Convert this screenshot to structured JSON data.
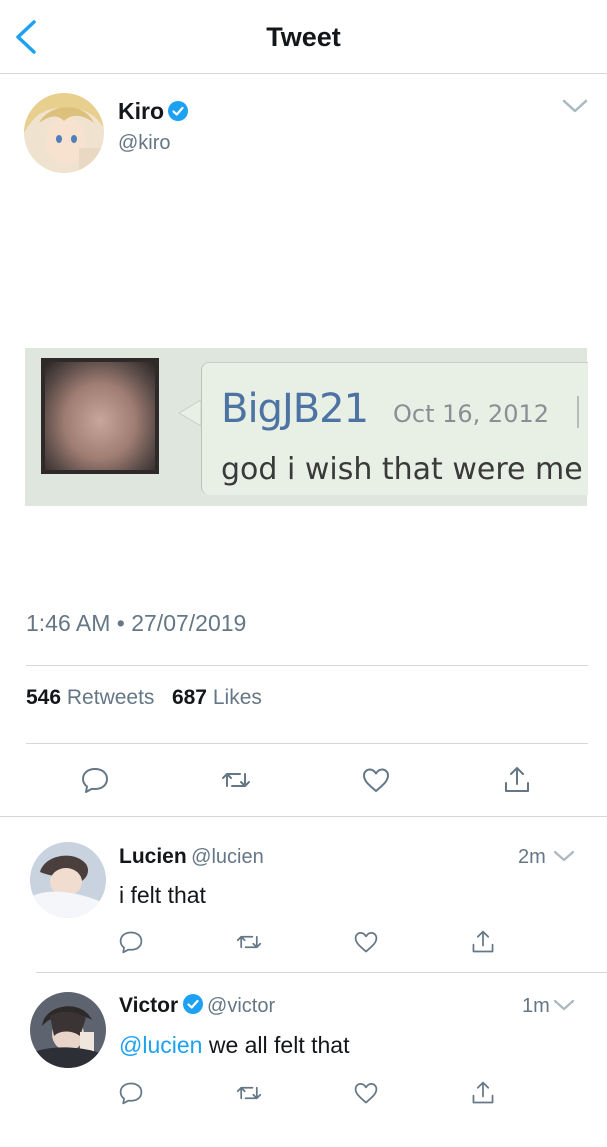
{
  "header": {
    "title": "Tweet"
  },
  "tweet": {
    "author_name": "Kiro",
    "author_handle": "@kiro",
    "timestamp": "1:46 AM • 27/07/2019",
    "retweets_count": "546",
    "retweets_label": "Retweets",
    "likes_count": "687",
    "likes_label": "Likes",
    "embedded": {
      "username": "BigJB21",
      "date": "Oct 16, 2012",
      "text": "god i wish that were me"
    }
  },
  "replies": [
    {
      "name": "Lucien",
      "handle": "@lucien",
      "time": "2m",
      "mention": "",
      "text": "i felt that",
      "verified": false
    },
    {
      "name": "Victor",
      "handle": "@victor",
      "time": "1m",
      "mention": "@lucien",
      "text": "we all felt that",
      "verified": true
    }
  ],
  "colors": {
    "accent": "#1da1f2",
    "muted": "#657786",
    "divider": "#d6d9db"
  },
  "icons": {
    "back": "chevron-left-icon",
    "more": "chevron-down-icon",
    "verified": "verified-badge-icon",
    "reply": "reply-icon",
    "retweet": "retweet-icon",
    "like": "heart-icon",
    "share": "share-icon"
  }
}
